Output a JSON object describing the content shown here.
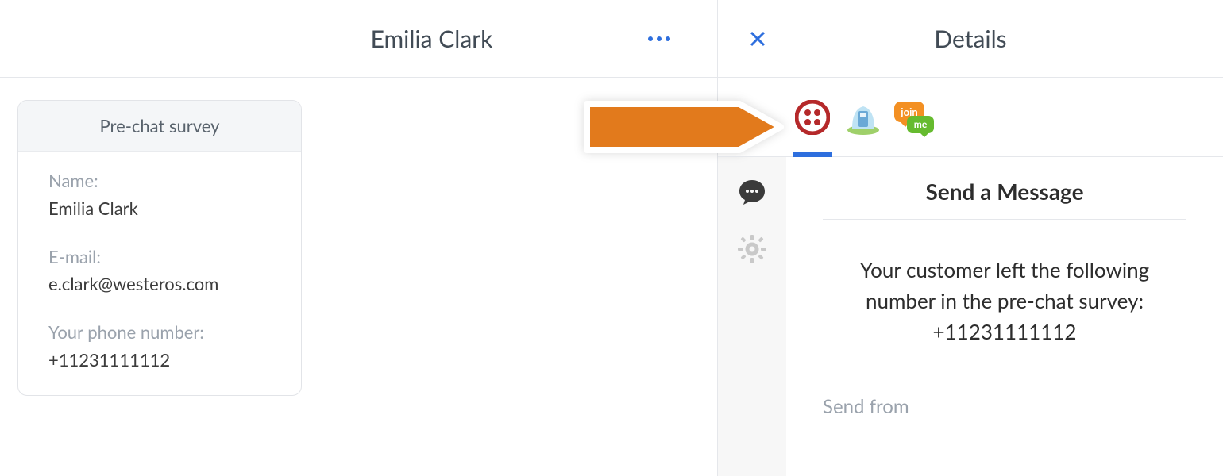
{
  "conversation": {
    "title": "Emilia Clark"
  },
  "details": {
    "title": "Details"
  },
  "survey": {
    "card_title": "Pre-chat survey",
    "fields": {
      "name": {
        "label": "Name:",
        "value": "Emilia Clark"
      },
      "email": {
        "label": "E-mail:",
        "value": "e.clark@westeros.com"
      },
      "phone": {
        "label": "Your phone number:",
        "value": "+11231111112"
      }
    }
  },
  "integrations": {
    "twilio_name": "Twilio",
    "fullcontact_name": "FullContact",
    "joinme_name": "join.me",
    "joinme_label_top": "join",
    "joinme_label_bottom": "me"
  },
  "twilio_panel": {
    "send_message_title": "Send a Message",
    "customer_number_text": "Your customer left the following number in the pre-chat survey: +11231111112",
    "send_from_label": "Send from"
  },
  "icons": {
    "more": "more-icon",
    "close": "close-icon",
    "twilio": "twilio-icon",
    "fullcontact": "fullcontact-icon",
    "joinme": "joinme-icon",
    "chat": "chat-bubble-icon",
    "gear": "gear-icon"
  },
  "colors": {
    "accent": "#2e6fde",
    "pointer": "#e27a1c",
    "twilio": "#b5292a",
    "border": "#e5e7eb",
    "muted": "#9aa2ac"
  }
}
